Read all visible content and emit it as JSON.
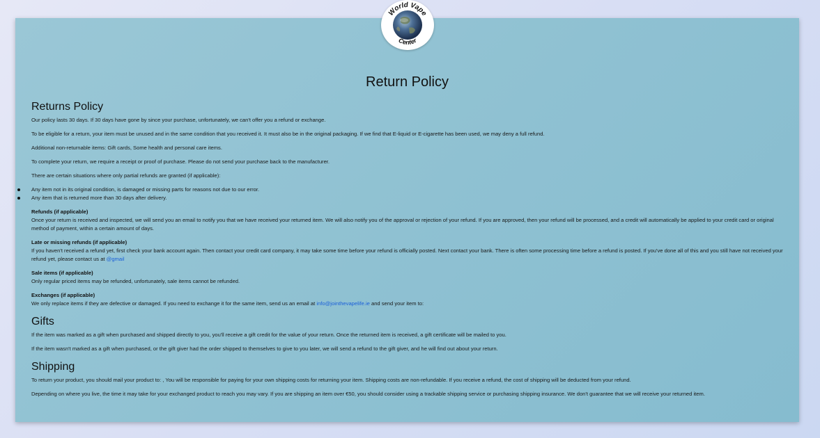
{
  "logo": {
    "text_top": "World Vape",
    "text_bottom": "Center",
    "icon": "globe-icon"
  },
  "page_title": "Return Policy",
  "returns": {
    "heading": "Returns Policy",
    "p1": "Our policy lasts 30 days. If 30 days have gone by since your purchase, unfortunately, we can't offer you a refund or exchange.",
    "p2": "To be eligible for a return, your item must be unused and in the same condition that you received it. It must also be in the original packaging. If we find that E-liquid or E-cigarette has been used, we may deny a full refund.",
    "p3": "Additional non-returnable items: Gift cards, Some health and personal care items.",
    "p4": "To complete your return, we require a receipt or proof of purchase. Please do not send your purchase back to the manufacturer.",
    "p5": "There are certain situations where only partial refunds are granted (if applicable):",
    "bullets": [
      "Any item not in its original condition, is damaged or missing parts for reasons not due to our error.",
      "Any item that is returned more than 30 days after delivery."
    ],
    "refunds_title": "Refunds (if applicable)",
    "refunds_text": "Once your return is received and inspected, we will send you an email to notify you that we have received your returned item. We will also notify you of the approval or rejection of your refund. If you are approved, then your refund will be processed, and a credit will automatically be applied to your credit card or original method of payment, within a certain amount of days.",
    "late_title": "Late or missing refunds (if applicable)",
    "late_text": "If you haven't received a refund yet, first check your bank account again. Then contact your credit card company, it may take some time before your refund is officially posted. Next contact your bank. There is often some processing time before a refund is posted. If you've done all of this and you still have not received your refund yet, please contact us at",
    "late_link": "@gmail",
    "sale_title": "Sale items (if applicable)",
    "sale_text": "Only regular priced items may be refunded, unfortunately, sale items cannot be refunded.",
    "exchanges_title": "Exchanges (if applicable)",
    "exchanges_text_before": "We only replace items if they are defective or damaged. If you need to exchange it for the same item, send us an email at",
    "exchanges_link": "info@jointhevapelife.ie",
    "exchanges_text_after": "and send your item to:"
  },
  "gifts": {
    "heading": "Gifts",
    "p1": "If the item was marked as a gift when purchased and shipped directly to you, you'll receive a gift credit for the value of your return. Once the returned item is received, a gift certificate will be mailed to you.",
    "p2": "If the item wasn't marked as a gift when purchased, or the gift giver had the order shipped to themselves to give to you later, we will send a refund to the gift giver, and he will find out about your return."
  },
  "shipping": {
    "heading": "Shipping",
    "p1": "To return your product, you should mail your product to: , You will be responsible for paying for your own shipping costs for returning your item. Shipping costs are non-refundable. If you receive a refund, the cost of shipping will be deducted from your refund.",
    "p2": "Depending on where you live, the time it may take for your exchanged product to reach you may vary. If you are shipping an item over €50, you should consider using a trackable shipping service or purchasing shipping insurance. We don't guarantee that we will receive your returned item."
  },
  "colors": {
    "card": "#8fc1d2",
    "link": "#1a5fd8",
    "background": "#d8def4"
  }
}
